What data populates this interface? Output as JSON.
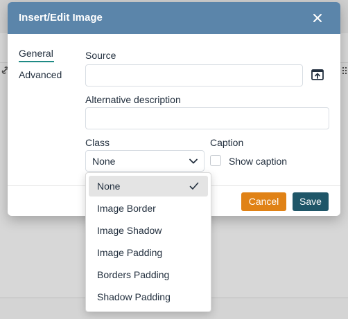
{
  "dialog": {
    "title": "Insert/Edit Image",
    "close_icon": "close-icon"
  },
  "tabs": [
    {
      "label": "General",
      "active": true
    },
    {
      "label": "Advanced",
      "active": false
    }
  ],
  "form": {
    "source": {
      "label": "Source",
      "value": "",
      "browse_icon": "browse-icon"
    },
    "alt": {
      "label": "Alternative description",
      "value": ""
    },
    "class": {
      "label": "Class",
      "value": "None",
      "chevron_icon": "chevron-down-icon"
    },
    "caption": {
      "label": "Caption",
      "checkbox_label": "Show caption",
      "checked": false
    }
  },
  "footer": {
    "cancel_label": "Cancel",
    "save_label": "Save"
  },
  "dropdown": {
    "selected": "None",
    "items": [
      "None",
      "Image Border",
      "Image Shadow",
      "Image Padding",
      "Borders Padding",
      "Shadow Padding"
    ]
  },
  "colors": {
    "header": "#5b85aa",
    "tab_underline": "#1f8a85",
    "cancel": "#e08216",
    "save": "#1f5668",
    "selected_item": "#e4e4e4"
  }
}
